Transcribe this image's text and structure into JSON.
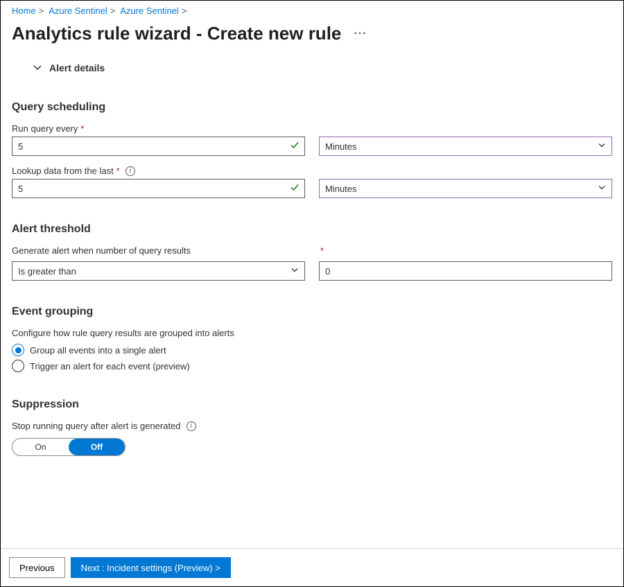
{
  "breadcrumb": {
    "items": [
      "Home",
      "Azure Sentinel",
      "Azure Sentinel"
    ]
  },
  "page_title": "Analytics rule wizard - Create new rule",
  "alert_details_header": "Alert details",
  "sections": {
    "scheduling": {
      "title": "Query scheduling",
      "run_every_label": "Run query every",
      "run_every_value": "5",
      "run_every_unit": "Minutes",
      "lookup_label": "Lookup data from the last",
      "lookup_value": "5",
      "lookup_unit": "Minutes"
    },
    "threshold": {
      "title": "Alert threshold",
      "condition_label": "Generate alert when number of query results",
      "operator": "Is greater than",
      "value": "0"
    },
    "grouping": {
      "title": "Event grouping",
      "description": "Configure how rule query results are grouped into alerts",
      "options": [
        "Group all events into a single alert",
        "Trigger an alert for each event (preview)"
      ]
    },
    "suppression": {
      "title": "Suppression",
      "label": "Stop running query after alert is generated",
      "on": "On",
      "off": "Off"
    }
  },
  "footer": {
    "previous": "Previous",
    "next": "Next : Incident settings (Preview) >"
  }
}
